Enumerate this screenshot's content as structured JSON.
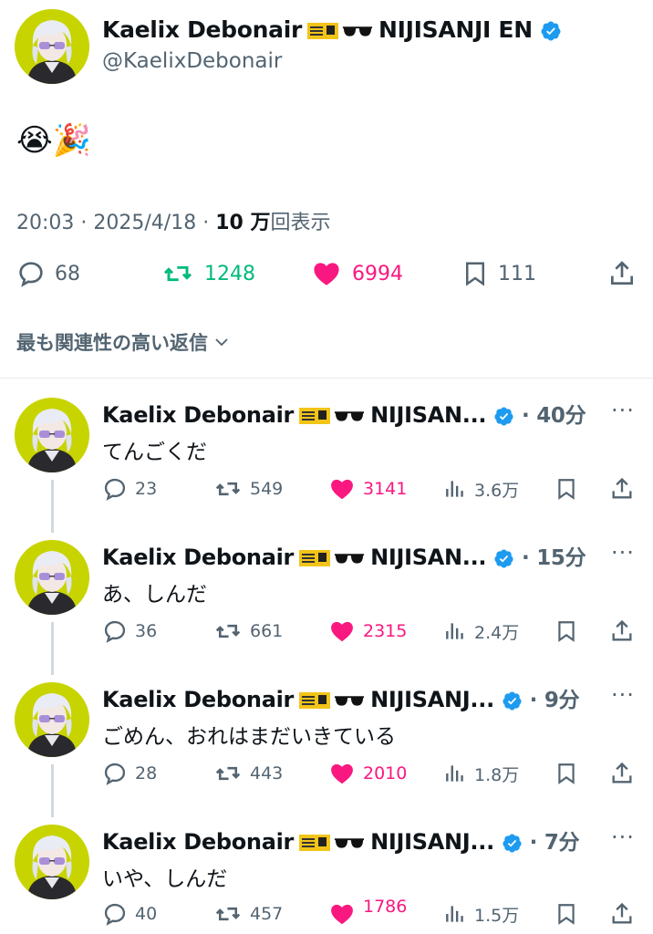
{
  "main_tweet": {
    "display_name": "Kaelix Debonair",
    "name_suffix": "NIJISANJI EN",
    "handle": "@KaelixDebonair",
    "body_emoji": "😭🎉",
    "time": "20:03",
    "date": "2025/4/18",
    "views_bold": "10 万",
    "views_suffix": "回表示",
    "replies": "68",
    "retweets": "1248",
    "likes": "6994",
    "bookmarks": "111"
  },
  "sort_label": "最も関連性の高い返信",
  "replies": [
    {
      "name": "Kaelix Debonair",
      "suffix": "NIJISAN...",
      "time": "40分",
      "text": "てんごくだ",
      "replies": "23",
      "retweets": "549",
      "likes": "3141",
      "views": "3.6万"
    },
    {
      "name": "Kaelix Debonair",
      "suffix": "NIJISAN...",
      "time": "15分",
      "text": "あ、しんだ",
      "replies": "36",
      "retweets": "661",
      "likes": "2315",
      "views": "2.4万"
    },
    {
      "name": "Kaelix Debonair",
      "suffix": "NIJISANJ...",
      "time": "9分",
      "text": "ごめん、おれはまだいきている",
      "replies": "28",
      "retweets": "443",
      "likes": "2010",
      "views": "1.8万"
    },
    {
      "name": "Kaelix Debonair",
      "suffix": "NIJISANJ...",
      "time": "7分",
      "text": "いや、しんだ",
      "replies": "40",
      "retweets": "457",
      "likes": "1786",
      "views": "1.5万"
    }
  ],
  "colors": {
    "accent_blue": "#1d9bf0",
    "retweet_green": "#00ba7c",
    "like_pink": "#f91880",
    "avatar_bg": "#c8d400"
  }
}
